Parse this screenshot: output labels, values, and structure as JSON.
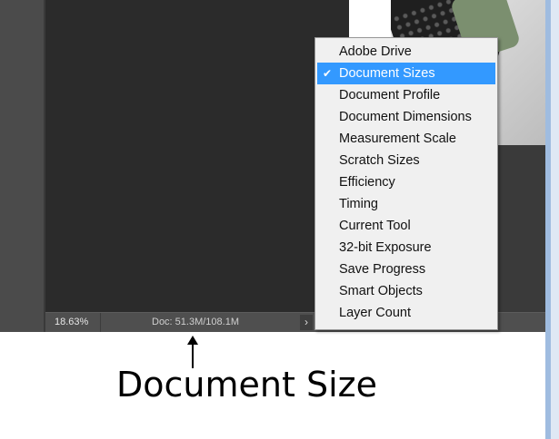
{
  "status_bar": {
    "zoom": "18.63%",
    "doc_info": "Doc: 51.3M/108.1M",
    "menu_arrow_glyph": "›"
  },
  "popup_menu": {
    "items": [
      {
        "label": "Adobe Drive",
        "checked": false
      },
      {
        "label": "Document Sizes",
        "checked": true
      },
      {
        "label": "Document Profile",
        "checked": false
      },
      {
        "label": "Document Dimensions",
        "checked": false
      },
      {
        "label": "Measurement Scale",
        "checked": false
      },
      {
        "label": "Scratch Sizes",
        "checked": false
      },
      {
        "label": "Efficiency",
        "checked": false
      },
      {
        "label": "Timing",
        "checked": false
      },
      {
        "label": "Current Tool",
        "checked": false
      },
      {
        "label": "32-bit Exposure",
        "checked": false
      },
      {
        "label": "Save Progress",
        "checked": false
      },
      {
        "label": "Smart Objects",
        "checked": false
      },
      {
        "label": "Layer Count",
        "checked": false
      }
    ],
    "check_glyph": "✔",
    "selected_color": "#3399ff"
  },
  "annotation": {
    "caption": "Document Size"
  }
}
